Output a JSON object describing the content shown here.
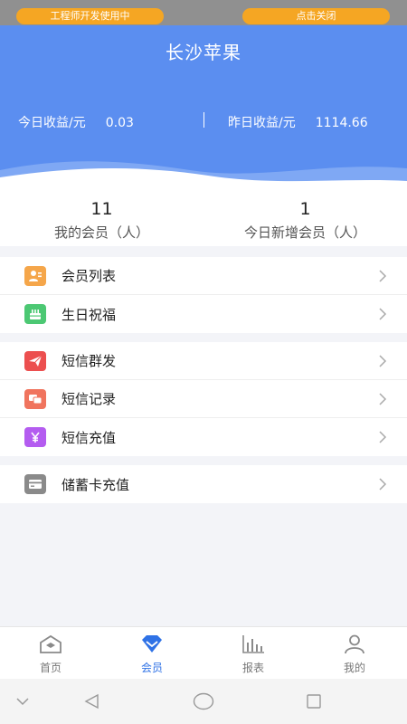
{
  "dev_strip": {
    "left_label": "工程师开发使用中",
    "right_label": "点击关闭"
  },
  "header": {
    "title": "长沙苹果",
    "today_income_label": "今日收益/元",
    "today_income_value": "0.03",
    "yesterday_income_label": "昨日收益/元",
    "yesterday_income_value": "1114.66"
  },
  "stats": {
    "my_members_count": "11",
    "my_members_label": "我的会员（人）",
    "new_members_count": "1",
    "new_members_label": "今日新增会员（人）"
  },
  "menu": {
    "group1": [
      {
        "label": "会员列表",
        "icon": "member-list-icon",
        "color": "#f5a64a"
      },
      {
        "label": "生日祝福",
        "icon": "birthday-cake-icon",
        "color": "#4cc873"
      }
    ],
    "group2": [
      {
        "label": "短信群发",
        "icon": "send-message-icon",
        "color": "#ec4f4f"
      },
      {
        "label": "短信记录",
        "icon": "message-record-icon",
        "color": "#f0745e"
      },
      {
        "label": "短信充值",
        "icon": "sms-recharge-icon",
        "color": "#b45cf0"
      }
    ],
    "group3": [
      {
        "label": "储蓄卡充值",
        "icon": "debit-card-icon",
        "color": "#8a8a8a"
      }
    ]
  },
  "tabbar": {
    "home": "首页",
    "members": "会员",
    "reports": "报表",
    "mine": "我的",
    "active_color": "#2f72e6",
    "inactive_color": "#777777"
  }
}
